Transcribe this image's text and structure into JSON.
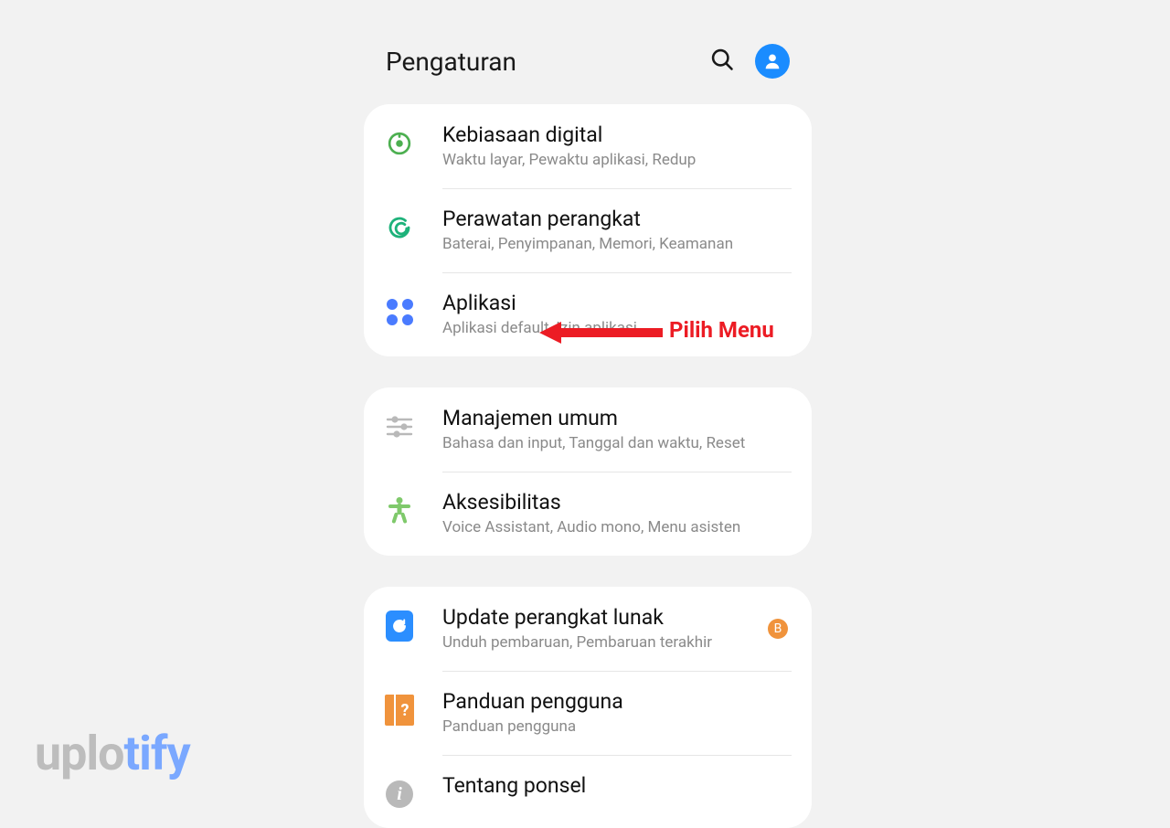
{
  "header": {
    "title": "Pengaturan"
  },
  "groups": [
    {
      "items": [
        {
          "title": "Kebiasaan digital",
          "subtitle": "Waktu layar, Pewaktu aplikasi, Redup"
        },
        {
          "title": "Perawatan perangkat",
          "subtitle": "Baterai, Penyimpanan, Memori, Keamanan"
        },
        {
          "title": "Aplikasi",
          "subtitle": "Aplikasi default, Izin aplikasi"
        }
      ]
    },
    {
      "items": [
        {
          "title": "Manajemen umum",
          "subtitle": "Bahasa dan input, Tanggal dan waktu, Reset"
        },
        {
          "title": "Aksesibilitas",
          "subtitle": "Voice Assistant, Audio mono, Menu asisten"
        }
      ]
    },
    {
      "items": [
        {
          "title": "Update perangkat lunak",
          "subtitle": "Unduh pembaruan, Pembaruan terakhir",
          "badge": "B"
        },
        {
          "title": "Panduan pengguna",
          "subtitle": "Panduan pengguna"
        },
        {
          "title": "Tentang ponsel",
          "subtitle": ""
        }
      ]
    }
  ],
  "annotation": {
    "label": "Pilih Menu"
  },
  "watermark": {
    "part1": "uplo",
    "part2": "tify"
  },
  "guide_glyph": "?",
  "info_glyph": "i"
}
